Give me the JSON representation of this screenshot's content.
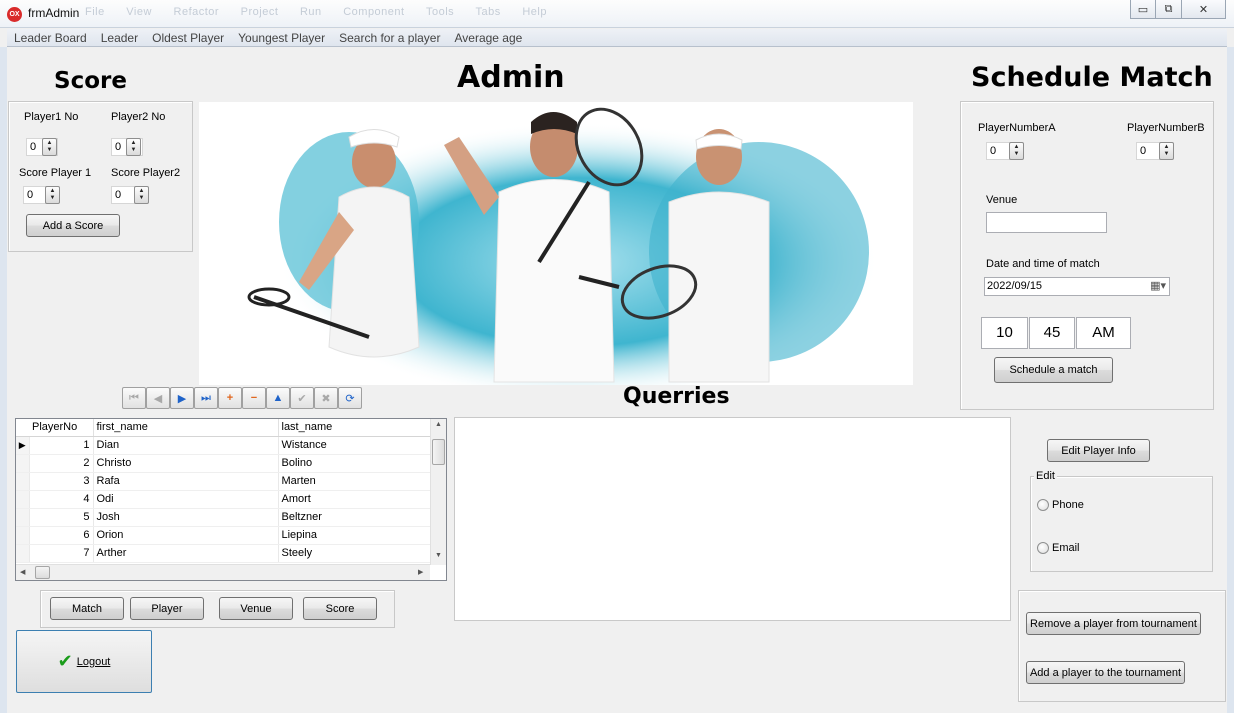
{
  "window": {
    "app_icon": "OX",
    "title": "frmAdmin",
    "ghost_menu": [
      "File",
      "View",
      "Refactor",
      "Project",
      "Run",
      "Component",
      "Tools",
      "Tabs",
      "Help"
    ],
    "min_icon": "▭",
    "max_icon": "⧉",
    "close_icon": "✕"
  },
  "menu": {
    "items": [
      "Leader Board",
      "Leader",
      "Oldest Player",
      "Youngest Player",
      "Search for a player",
      "Average age"
    ]
  },
  "score": {
    "title": "Score",
    "player1_no_label": "Player1 No",
    "player2_no_label": "Player2 No",
    "score_player1_label": "Score Player 1",
    "score_player2_label": "Score Player2",
    "player1_no": "0",
    "player2_no": "0",
    "score_player1": "0",
    "score_player2": "0",
    "add_button": "Add a Score"
  },
  "admin": {
    "title": "Admin"
  },
  "schedule": {
    "title": "Schedule Match",
    "player_a_label": "PlayerNumberA",
    "player_b_label": "PlayerNumberB",
    "player_a": "0",
    "player_b": "0",
    "venue_label": "Venue",
    "venue_value": "",
    "datetime_label": "Date and time of match",
    "date_value": "2022/09/15",
    "hour": "10",
    "minute": "45",
    "ampm": "AM",
    "button": "Schedule a match"
  },
  "queries": {
    "title": "Querries"
  },
  "grid": {
    "columns": [
      "PlayerNo",
      "first_name",
      "last_name"
    ],
    "rows": [
      {
        "no": "1",
        "first": "Dian",
        "last": "Wistance"
      },
      {
        "no": "2",
        "first": "Christo",
        "last": "Bolino"
      },
      {
        "no": "3",
        "first": "Rafa",
        "last": "Marten"
      },
      {
        "no": "4",
        "first": "Odi",
        "last": "Amort"
      },
      {
        "no": "5",
        "first": "Josh",
        "last": "Beltzner"
      },
      {
        "no": "6",
        "first": "Orion",
        "last": "Liepina"
      },
      {
        "no": "7",
        "first": "Arther",
        "last": "Steely"
      }
    ]
  },
  "table_buttons": [
    "Match",
    "Player",
    "Venue",
    "Score"
  ],
  "edit": {
    "edit_info_button": "Edit Player Info",
    "group_label": "Edit",
    "phone": "Phone",
    "email": "Email"
  },
  "tournament": {
    "remove_button": "Remove a player from tournament",
    "add_button": "Add a player to the tournament"
  },
  "logout": {
    "label": "Logout"
  }
}
